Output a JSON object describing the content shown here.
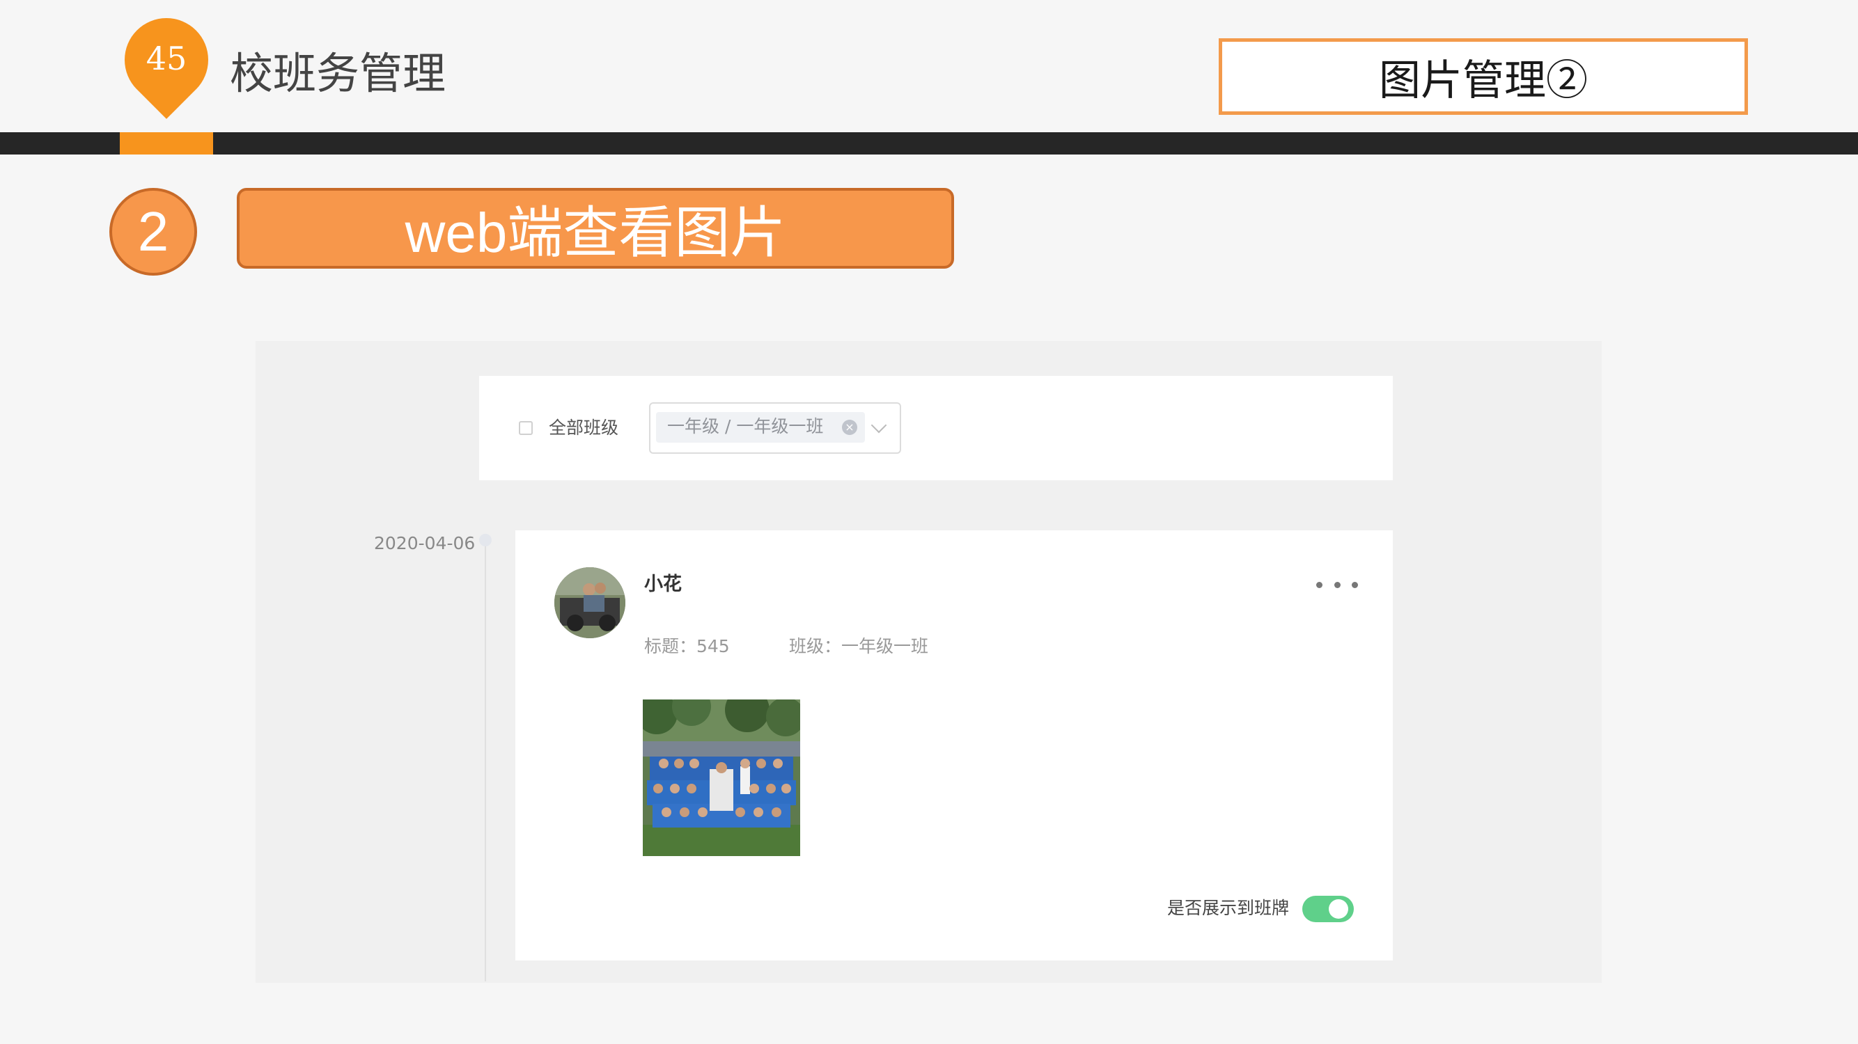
{
  "header": {
    "page_number": "45",
    "title": "校班务管理",
    "section_title": "图片管理②",
    "accent_color": "#f7941d",
    "bar_color": "#262626"
  },
  "step": {
    "number": "2",
    "title": "web端查看图片",
    "color": "#f7974b"
  },
  "filter": {
    "checkbox_label": "全部班级",
    "checkbox_checked": false,
    "selected_class_tag": "一年级 / 一年级一班",
    "tag_close_icon": "close-circle-icon",
    "dropdown_icon": "chevron-down-icon"
  },
  "timeline": {
    "date": "2020-04-06"
  },
  "post": {
    "author": "小花",
    "title_text": "标题：545",
    "class_text": "班级：一年级一班",
    "more_icon": "more-horizontal-icon",
    "photo_icon": "class-group-photo",
    "toggle_label": "是否展示到班牌",
    "toggle_on": true,
    "toggle_color": "#5fd08a"
  }
}
